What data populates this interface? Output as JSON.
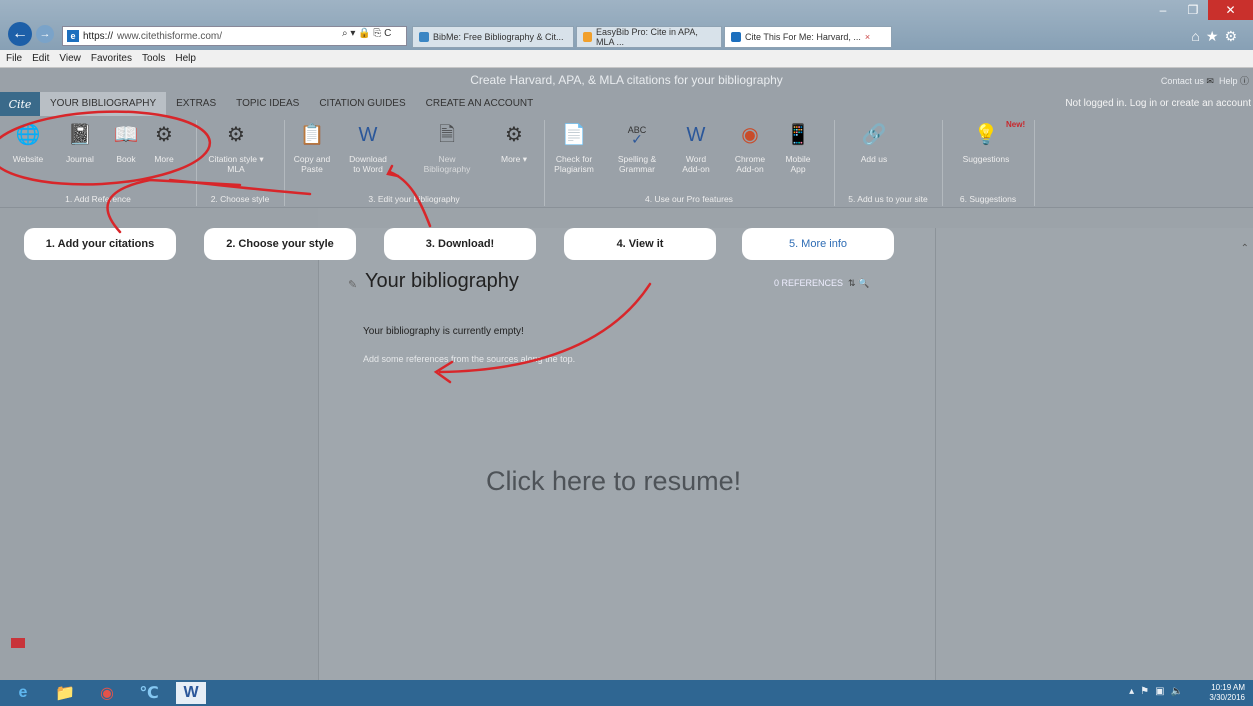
{
  "browser": {
    "url_prefix": "https://",
    "url_host": "www.citethisforme.com/",
    "addr_controls": "⌕ ▾ 🔒 ⎘ C",
    "tabs": [
      {
        "label": "BibMe: Free Bibliography & Cit...",
        "active": false
      },
      {
        "label": "EasyBib Pro: Cite in APA, MLA ...",
        "active": false
      },
      {
        "label": "Cite This For Me: Harvard, ...",
        "active": true
      }
    ],
    "tab_close": "×",
    "menu": [
      "File",
      "Edit",
      "View",
      "Favorites",
      "Tools",
      "Help"
    ]
  },
  "header": {
    "tagline": "Create Harvard, APA, & MLA citations for your bibliography",
    "contact": "Contact us",
    "help": "Help"
  },
  "nav": {
    "logo": "Cite",
    "items": [
      "YOUR BIBLIOGRAPHY",
      "EXTRAS",
      "TOPIC IDEAS",
      "CITATION GUIDES",
      "CREATE AN ACCOUNT"
    ],
    "login": "Not logged in. Log in or create an account"
  },
  "toolbar": {
    "buttons": {
      "website": "Website",
      "journal": "Journal",
      "book": "Book",
      "more1": "More",
      "citation_style": "Citation style",
      "citation_style_value": "MLA",
      "copy_paste_1": "Copy and",
      "copy_paste_2": "Paste",
      "download_1": "Download",
      "download_2": "to Word",
      "new_bib_1": "New",
      "new_bib_2": "Bibliography",
      "more2": "More",
      "plagiarism_1": "Check for",
      "plagiarism_2": "Plagiarism",
      "spelling_1": "Spelling &",
      "spelling_2": "Grammar",
      "word_1": "Word",
      "word_2": "Add-on",
      "chrome_1": "Chrome",
      "chrome_2": "Add-on",
      "mobile_1": "Mobile",
      "mobile_2": "App",
      "add_us": "Add us",
      "suggestions": "Suggestions",
      "new_badge": "New!",
      "abc": "ABC"
    },
    "groups": {
      "g1": "1. Add Reference",
      "g2": "2. Choose style",
      "g3": "3. Edit your bibliography",
      "g4": "4. Use our Pro features",
      "g5": "5. Add us to your site",
      "g6": "6. Suggestions"
    }
  },
  "steps": [
    "1. Add your citations",
    "2. Choose your style",
    "3. Download!",
    "4. View it",
    "5. More info"
  ],
  "bibliography": {
    "title": "Your bibliography",
    "ref_count": "0 REFERENCES",
    "empty": "Your bibliography is currently empty!",
    "hint": "Add some references from the sources along the top.",
    "resume": "Click here to resume!"
  },
  "taskbar": {
    "time": "10:19 AM",
    "date": "3/30/2016"
  },
  "colors": {
    "annotation_red": "#d8262a",
    "taskbar": "#2f6692",
    "link_blue": "#2f6db5"
  }
}
